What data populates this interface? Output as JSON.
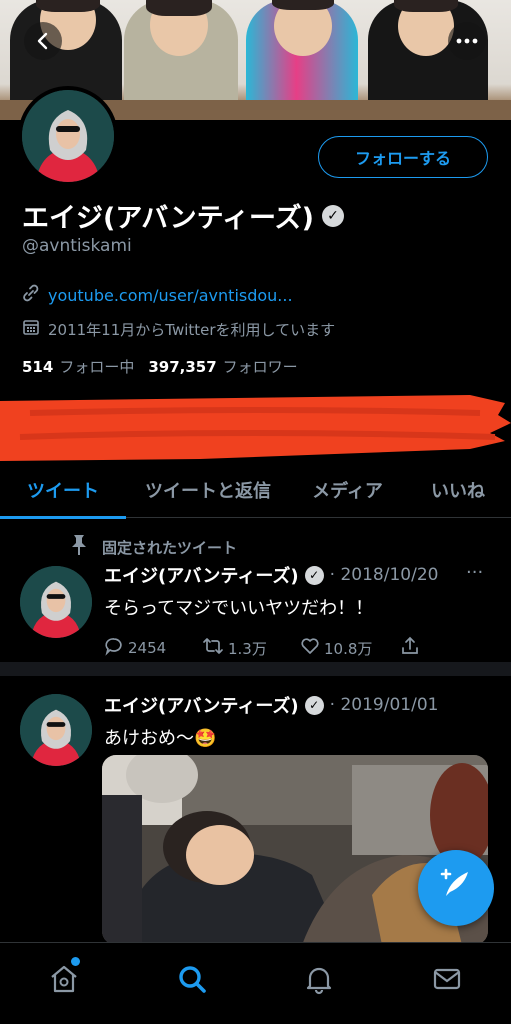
{
  "profile": {
    "display_name": "エイジ(アバンティーズ)",
    "handle": "@avntiskami",
    "link": "youtube.com/user/avntisdou...",
    "joined": "2011年11月からTwitterを利用しています",
    "following_count": "514",
    "following_label": "フォロー中",
    "followers_count": "397,357",
    "followers_label": "フォロワー",
    "follow_button": "フォローする"
  },
  "tabs": [
    "ツイート",
    "ツイートと返信",
    "メディア",
    "いいね"
  ],
  "pinned_tweet": {
    "pinned_label": "固定されたツイート",
    "name": "エイジ(アバンティーズ)",
    "date": "· 2018/10/20",
    "text": "そらってマジでいいヤツだわ！！",
    "replies": "2454",
    "retweets": "1.3万",
    "likes": "10.8万"
  },
  "tweet2": {
    "name": "エイジ(アバンティーズ)",
    "date": "· 2019/01/01",
    "text": "あけおめ〜🤩"
  },
  "colors": {
    "accent": "#1d9bf0",
    "background": "#000000",
    "redaction": "#f0411f"
  },
  "icons": {
    "back": "back-arrow-icon",
    "more": "more-icon",
    "link": "link-icon",
    "calendar": "calendar-icon",
    "pin": "pin-icon",
    "reply": "reply-icon",
    "retweet": "retweet-icon",
    "like": "heart-icon",
    "share": "share-icon",
    "compose": "compose-tweet-icon",
    "home": "home-icon",
    "search": "search-icon",
    "notifications": "bell-icon",
    "messages": "envelope-icon"
  }
}
